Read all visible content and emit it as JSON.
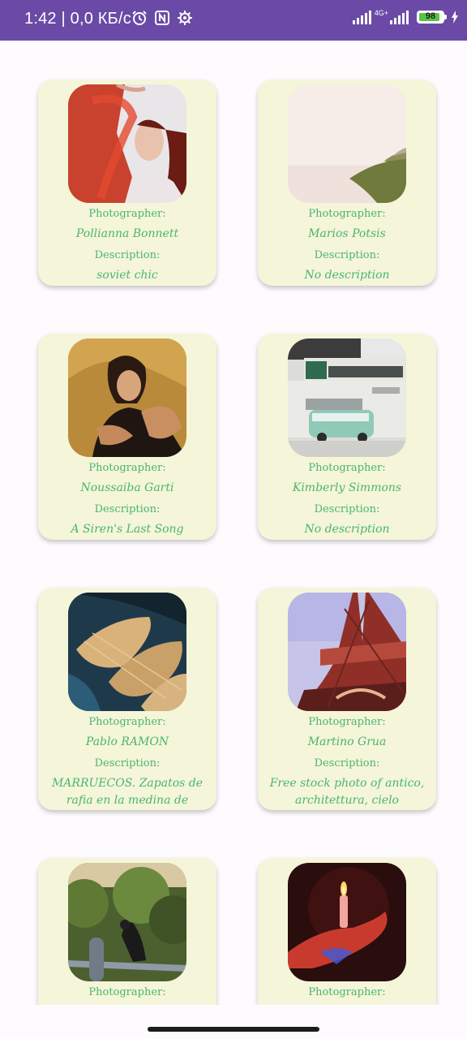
{
  "status_bar": {
    "time": "1:42 | 0,0 КБ/с",
    "network_type": "4G+",
    "battery_level": "98",
    "icons": [
      "alarm-icon",
      "nfc-icon",
      "settings-gear-icon",
      "signal-icon",
      "signal-icon",
      "battery-icon",
      "charging-icon"
    ]
  },
  "labels": {
    "photographer": "Photographer:",
    "description": "Description:"
  },
  "cards": [
    {
      "photographer": "Pollianna Bonnett",
      "description": "soviet chic",
      "image": "woman-red-scarf-photo"
    },
    {
      "photographer": "Marios Potsis",
      "description": "No description",
      "image": "misty-coast-photo"
    },
    {
      "photographer": "Noussaiba  Garti",
      "description": "A Siren's Last Song",
      "image": "woman-portrait-photo"
    },
    {
      "photographer": "Kimberly Simmons",
      "description": "No description",
      "image": "van-building-photo"
    },
    {
      "photographer": "Pablo RAMON",
      "description": "MARRUECOS. Zapatos de rafia en la medina de Essaouira.",
      "image": "raffia-shoes-photo"
    },
    {
      "photographer": "Martino Grua",
      "description": "Free stock photo of antico, architettura, cielo",
      "image": "eiffel-tower-photo"
    },
    {
      "photographer": "",
      "description": "",
      "image": "crow-on-pipe-photo"
    },
    {
      "photographer": "",
      "description": "",
      "image": "hand-candle-photo"
    }
  ]
}
